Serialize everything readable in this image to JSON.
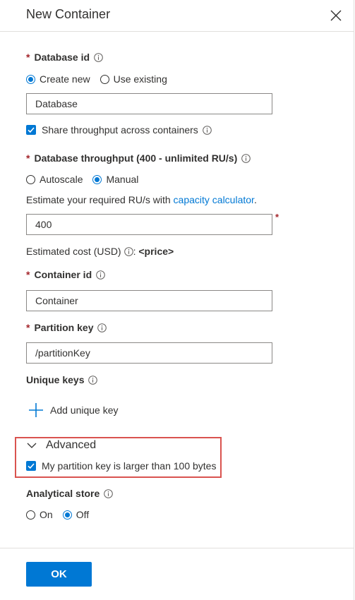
{
  "header": {
    "title": "New Container"
  },
  "database": {
    "label": "Database id",
    "radio_options": [
      "Create new",
      "Use existing"
    ],
    "selected": "Create new",
    "value": "Database",
    "share_throughput_label": "Share throughput across containers",
    "share_throughput_checked": true
  },
  "throughput": {
    "label": "Database throughput (400 - unlimited RU/s)",
    "radio_options": [
      "Autoscale",
      "Manual"
    ],
    "selected": "Manual",
    "estimate_prefix": "Estimate your required RU/s with ",
    "estimate_link": "capacity calculator",
    "estimate_suffix": ".",
    "value": "400",
    "required_mark": "*"
  },
  "cost": {
    "label": "Estimated cost (USD)",
    "suffix": ": ",
    "value": "<price>"
  },
  "container": {
    "label": "Container id",
    "value": "Container"
  },
  "partition": {
    "label": "Partition key",
    "value": "/partitionKey"
  },
  "unique_keys": {
    "label": "Unique keys",
    "add_label": "Add unique key"
  },
  "advanced": {
    "label": "Advanced",
    "large_key_label": "My partition key is larger than 100 bytes",
    "large_key_checked": true
  },
  "analytical": {
    "label": "Analytical store",
    "radio_options": [
      "On",
      "Off"
    ],
    "selected": "Off"
  },
  "footer": {
    "ok_label": "OK"
  },
  "colors": {
    "accent": "#0078d4",
    "required": "#a4262c",
    "highlight_border": "#d9534f"
  },
  "icons": {
    "close": "close-icon",
    "info": "info-icon",
    "add": "plus-icon",
    "chevron": "chevron-down-icon",
    "check": "checkmark-icon"
  }
}
